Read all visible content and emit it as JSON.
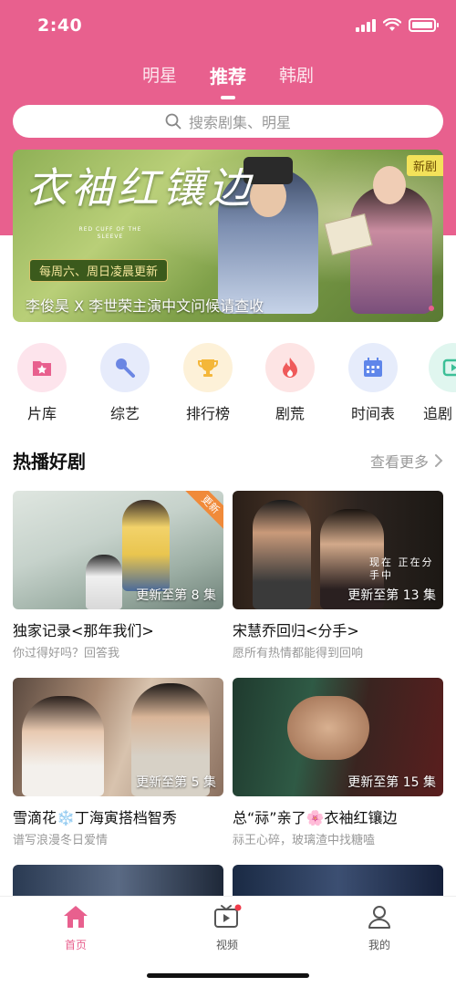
{
  "status": {
    "time": "2:40"
  },
  "top_tabs": [
    {
      "label": "明星"
    },
    {
      "label": "推荐"
    },
    {
      "label": "韩剧"
    }
  ],
  "search": {
    "placeholder": "搜索剧集、明星"
  },
  "banner": {
    "title": "衣袖红镶边",
    "subtitle": "RED CUFF OF THE SLEEVE",
    "schedule": "每周六、周日凌晨更新",
    "caption": "李俊昊 X 李世荣主演中文问候请查收",
    "badge": "新剧"
  },
  "quick_links": [
    {
      "label": "片库",
      "icon": "star-folder-icon",
      "bg": "#fde4ec",
      "fg": "#e8608e"
    },
    {
      "label": "综艺",
      "icon": "microphone-icon",
      "bg": "#e6ebfb",
      "fg": "#6b86e3"
    },
    {
      "label": "排行榜",
      "icon": "trophy-icon",
      "bg": "#fdf1d8",
      "fg": "#f4b73a"
    },
    {
      "label": "剧荒",
      "icon": "fire-icon",
      "bg": "#fde4e4",
      "fg": "#ef5a5a"
    },
    {
      "label": "时间表",
      "icon": "calendar-icon",
      "bg": "#e6ecfb",
      "fg": "#5f86ea"
    },
    {
      "label": "追剧",
      "icon": "play-screen-icon",
      "bg": "#e0f6ef",
      "fg": "#3cbf97"
    }
  ],
  "hot_section": {
    "title": "热播好剧",
    "more": "查看更多"
  },
  "cards": [
    {
      "title": "独家记录<那年我们>",
      "sub": "你过得好吗？回答我",
      "episode": "更新至第 8 集",
      "tag": "更新"
    },
    {
      "title": "宋慧乔回归<分手>",
      "sub": "愿所有热情都能得到回响",
      "episode": "更新至第 13 集",
      "overlay": "现在 正在分手中"
    },
    {
      "title": "雪滴花❄️丁海寅搭档智秀",
      "sub": "谱写浪漫冬日爱情",
      "episode": "更新至第 5 集"
    },
    {
      "title": "总“祘”亲了🌸衣袖红镶边",
      "sub": "祘王心碎，玻璃渣中找糖嗑",
      "episode": "更新至第 15 集"
    }
  ],
  "tabbar": [
    {
      "label": "首页",
      "icon": "home-icon"
    },
    {
      "label": "视频",
      "icon": "tv-icon"
    },
    {
      "label": "我的",
      "icon": "profile-icon"
    }
  ],
  "colors": {
    "brand": "#e8608e",
    "text": "#222222",
    "muted": "#999999"
  }
}
